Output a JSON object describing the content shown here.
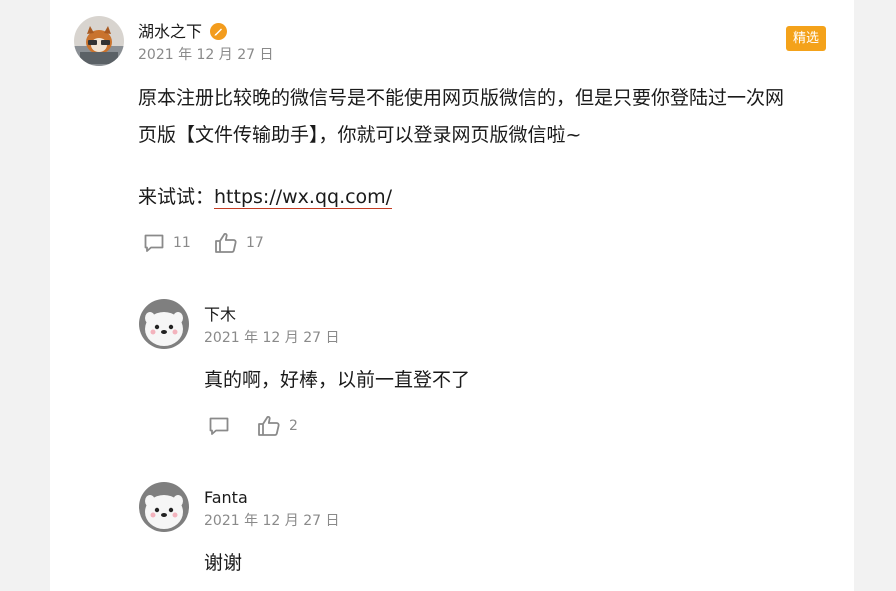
{
  "post": {
    "author": "湖水之下",
    "date": "2021 年 12 月 27 日",
    "badge": "精选",
    "content_lines": [
      "原本注册比较晚的微信号是不能使用网页版微信的，但是只要你登陆过一次网",
      "页版【文件传输助手】，你就可以登录网页版微信啦~"
    ],
    "try_prefix": "来试试：",
    "try_link": "https://wx.qq.com/",
    "comment_count": "11",
    "like_count": "17"
  },
  "replies": [
    {
      "author": "下木",
      "date": "2021 年 12 月 27 日",
      "text": "真的啊，好棒，以前一直登不了",
      "like_count": "2"
    },
    {
      "author": "Fanta",
      "date": "2021 年 12 月 27 日",
      "text": "谢谢"
    }
  ],
  "colors": {
    "badge": "#f4a21a",
    "verified": "#f39c1d",
    "link_underline": "#c23b22",
    "meta": "#8a8a8a"
  }
}
